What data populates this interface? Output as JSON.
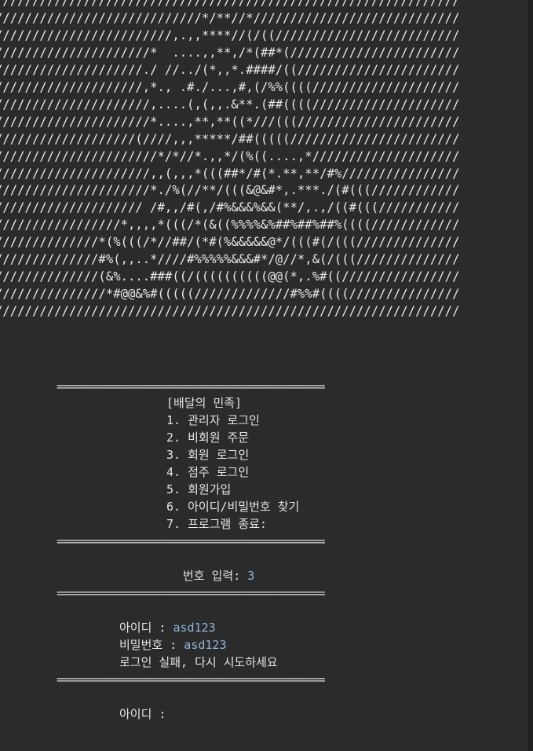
{
  "console": {
    "ascii_art": [
      "///////////////////////////////////////////////////////////////",
      "////////////////////////////*/**//*////////////////////////////",
      "////////////////////////,.,,****//(/((/////////////////////////",
      "/////////////////////*  ....,,**,/*(##*(///////////////////////",
      "////////////////////./ //../(*,,*.####/((//////////////////////",
      "////////////////////,*., .#./...,#,(/%%((((////////////////////",
      "/////////////////////,....(,(,,.&**.(##((((////////////////////",
      "/////////////////////*....,**,**((*///(((//////////////////////",
      "///////////////////(////,,,*****/##(((((///////////////////////",
      "//////////////////////*/*//*.,,*/(%((....,*////////////////////",
      "/////////////////////,,(,,,*(((##*/#(*.**,**/#%////////////////",
      "/////////////////////*./%(//**/(((&@&#*,.***./(#(((////////////",
      "//////////////////// /#,,/#(,/#%&&&%&&(**/,.,/((#(((///////////",
      "/////////////////*,,,,*(((/*(&((%%%%&%##%##%##%((((////////////",
      "//////////////*(%(((/*//##/(*#(%&&&&&@*/(((#(/(((//////////////",
      "//////////////#%(,,..*////#%%%%%&&&#*/@//*,&(/(((//////////////",
      "//////////////(&%....###((/((((((((((@@(*,.%#((////////////////",
      "///////////////*#@@&%#(((((/////////////#%%#((((///////////////",
      "///////////////////////////////////////////////////////////////"
    ],
    "separator": "=============================================",
    "menu": {
      "title": "[배달의 민족]",
      "items": [
        "1. 관리자 로그인",
        "2. 비회원 주문",
        "3. 회원 로그인",
        "4. 점주 로그인",
        "5. 회원가입",
        "6. 아이디/비밀번호 찾기",
        "7. 프로그램 종료:"
      ]
    },
    "number_prompt": "번호 입력: ",
    "number_value": "3",
    "login": {
      "id_label": "아이디 : ",
      "id_value": "asd123",
      "pw_label": "비밀번호 : ",
      "pw_value": "asd123",
      "fail_message": "로그인 실패, 다시 시도하세요",
      "id_prompt_again": "아이디 :"
    }
  }
}
